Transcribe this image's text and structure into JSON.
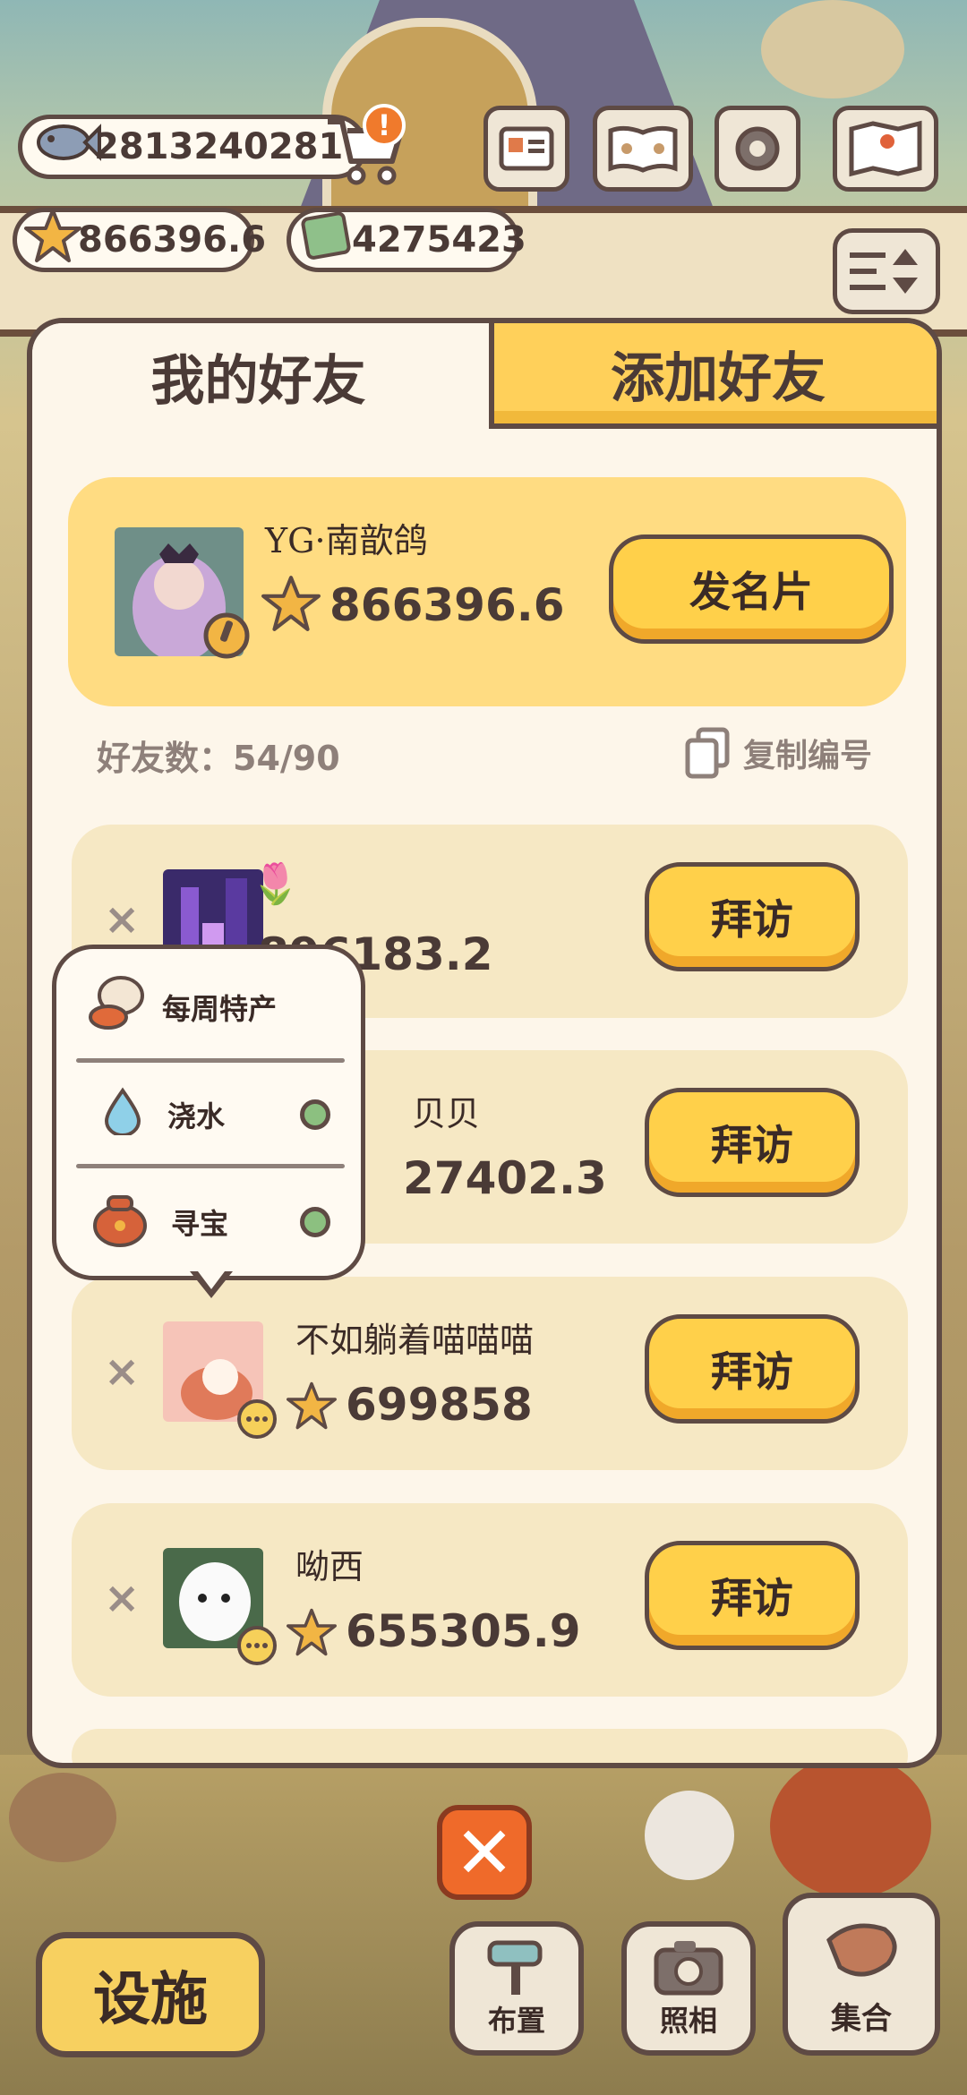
{
  "hud": {
    "fish_currency": "2813240281",
    "star_currency": "866396.6",
    "cash_currency": "4275423",
    "notification_badge": "!"
  },
  "tabs": {
    "my_friends": "我的好友",
    "add_friend": "添加好友"
  },
  "me": {
    "name": "YG·南歆鸽",
    "score": "866396.6",
    "send_card_label": "发名片"
  },
  "friends_count_label": "好友数：54/90",
  "copy_id_label": "复制编号",
  "friends": [
    {
      "name": "🌷",
      "score": "896183.2",
      "visit_label": "拜访",
      "remove": "×"
    },
    {
      "name": "贝贝",
      "score": "27402.3",
      "visit_label": "拜访",
      "remove": "×"
    },
    {
      "name": "不如躺着喵喵喵",
      "score": "699858",
      "visit_label": "拜访",
      "remove": "×"
    },
    {
      "name": "呦西",
      "score": "655305.9",
      "visit_label": "拜访",
      "remove": "×"
    }
  ],
  "popup": {
    "weekly_special": "每周特产",
    "watering": "浇水",
    "treasure_hunt": "寻宝"
  },
  "bottom_bar": {
    "facility": "设施",
    "layout": "布置",
    "photo": "照相",
    "gather": "集合",
    "close": "✕"
  },
  "colors": {
    "accent_yellow": "#ffd04a",
    "outline_brown": "#5e4a44",
    "panel_bg": "#fdf6ea",
    "close_orange": "#ef6a2a"
  }
}
